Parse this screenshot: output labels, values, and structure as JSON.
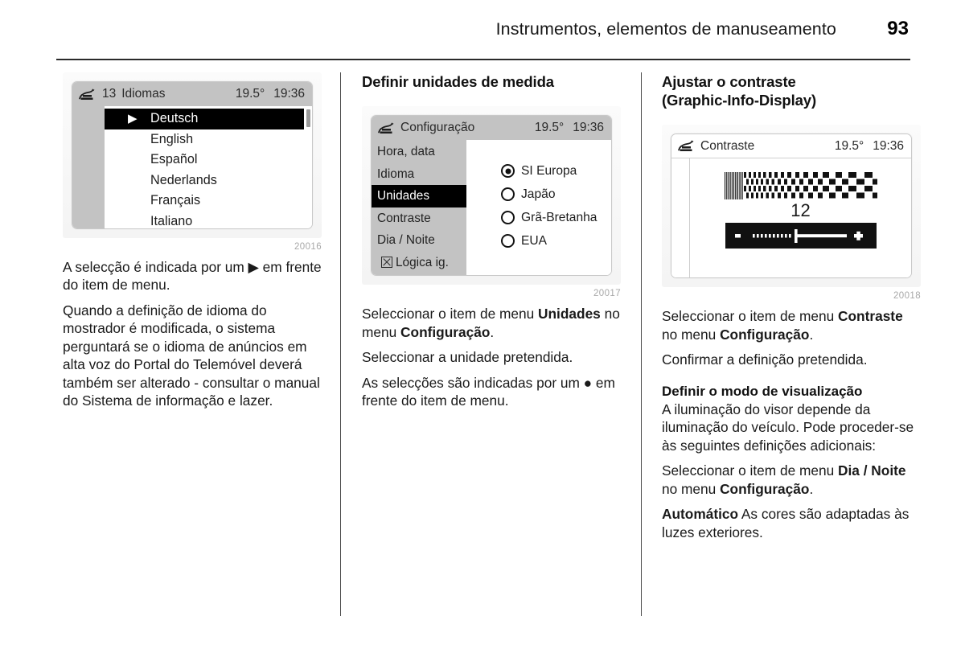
{
  "header": {
    "title": "Instrumentos, elementos de manuseamento",
    "page_number": "93"
  },
  "columns": {
    "left": {
      "figure": {
        "caption": "20016",
        "display": {
          "icon": "car-display-icon",
          "index": "13",
          "title": "Idiomas",
          "temperature": "19.5°",
          "time": "19:36",
          "items": [
            {
              "label": "Deutsch",
              "selected": true,
              "marker": "▶"
            },
            {
              "label": "English",
              "selected": false
            },
            {
              "label": "Español",
              "selected": false
            },
            {
              "label": "Nederlands",
              "selected": false
            },
            {
              "label": "Français",
              "selected": false
            },
            {
              "label": "Italiano",
              "selected": false
            }
          ]
        }
      },
      "paragraphs": [
        "A selecção é indicada por um ▶ em frente do item de menu.",
        "Quando a definição de idioma do mostrador é modificada, o sistema perguntará se o idioma de anúncios em alta voz do Portal do Telemóvel deverá também ser alterado - consultar o manual do Sistema de informação e lazer."
      ]
    },
    "middle": {
      "heading": "Definir unidades de medida",
      "figure": {
        "caption": "20017",
        "display": {
          "icon": "car-display-icon",
          "title": "Configuração",
          "temperature": "19.5°",
          "time": "19:36",
          "menu_items": [
            {
              "label": "Hora, data",
              "selected": false,
              "checkbox": false
            },
            {
              "label": "Idioma",
              "selected": false,
              "checkbox": false
            },
            {
              "label": "Unidades",
              "selected": true,
              "checkbox": false
            },
            {
              "label": "Contraste",
              "selected": false,
              "checkbox": false
            },
            {
              "label": "Dia / Noite",
              "selected": false,
              "checkbox": false
            },
            {
              "label": "Lógica ig.",
              "selected": false,
              "checkbox": true
            }
          ],
          "options": [
            {
              "label": "SI Europa",
              "selected": true
            },
            {
              "label": "Japão",
              "selected": false
            },
            {
              "label": "Grã-Bretanha",
              "selected": false
            },
            {
              "label": "EUA",
              "selected": false
            }
          ]
        }
      },
      "paragraphs": [
        {
          "html": "Seleccionar o item de menu <b>Unidades</b> no menu <b>Configuração</b>."
        },
        {
          "html": "Seleccionar a unidade pretendida."
        },
        {
          "html": "As selecções são indicadas por um ● em frente do item de menu."
        }
      ]
    },
    "right": {
      "heading_line1": "Ajustar o contraste",
      "heading_line2": "(Graphic-Info-Display)",
      "figure": {
        "caption": "20018",
        "display": {
          "icon": "car-display-icon",
          "title": "Contraste",
          "temperature": "19.5°",
          "time": "19:36",
          "contrast_value": "12",
          "slider": {
            "min_label": "−",
            "max_label": "+",
            "position_percent": 47
          }
        }
      },
      "paragraphs_top": [
        {
          "html": "Seleccionar o item de menu <b>Contraste</b> no menu <b>Configuração</b>."
        },
        {
          "html": "Confirmar a definição pretendida."
        }
      ],
      "sub_heading": "Definir o modo de visualização",
      "paragraphs_bottom": [
        {
          "html": "A iluminação do visor depende da iluminação do veículo. Pode proceder-se às seguintes definições adicionais:"
        },
        {
          "html": "Seleccionar o item de menu <b>Dia / Noite</b> no menu <b>Configuração</b>."
        },
        {
          "html": "<b>Automático</b> As cores são adaptadas às luzes exteriores."
        }
      ]
    }
  }
}
